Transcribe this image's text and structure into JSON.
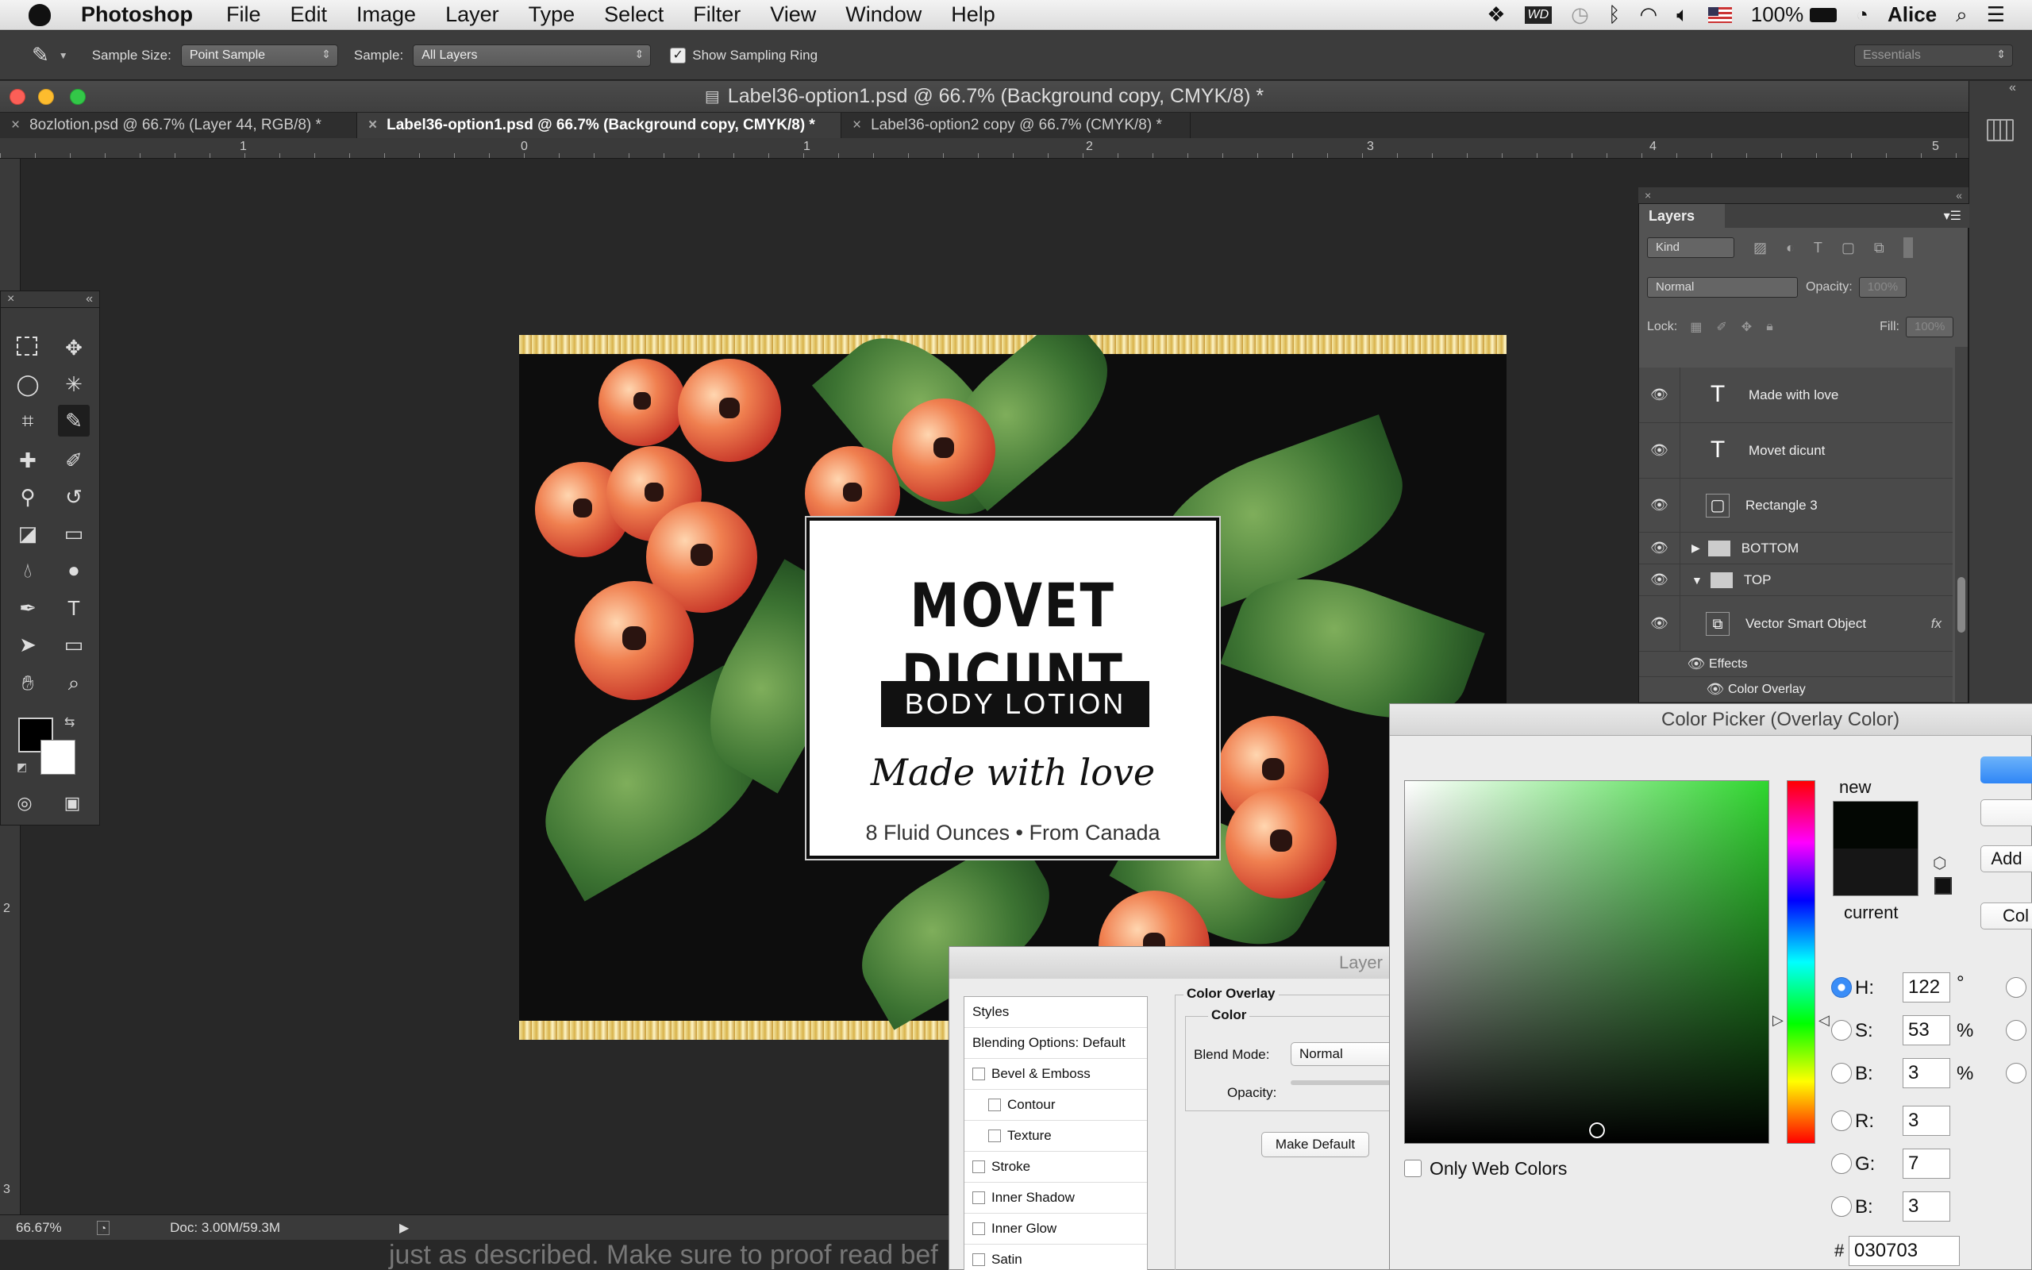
{
  "menubar": {
    "app": "Photoshop",
    "items": [
      "File",
      "Edit",
      "Image",
      "Layer",
      "Type",
      "Select",
      "Filter",
      "View",
      "Window",
      "Help"
    ],
    "battery": "100%",
    "user": "Alice"
  },
  "options": {
    "sample_size_label": "Sample Size:",
    "sample_size_value": "Point Sample",
    "sample_label": "Sample:",
    "sample_value": "All Layers",
    "show_ring_label": "Show Sampling Ring",
    "workspace": "Essentials"
  },
  "window": {
    "title": "Label36-option1.psd @ 66.7% (Background copy, CMYK/8) *",
    "tabs": [
      {
        "label": "8ozlotion.psd @ 66.7% (Layer 44, RGB/8) *"
      },
      {
        "label": "Label36-option1.psd @ 66.7% (Background copy, CMYK/8) *"
      },
      {
        "label": "Label36-option2 copy @ 66.7% (CMYK/8) *"
      }
    ],
    "ruler": [
      "1",
      "0",
      "1",
      "2",
      "3",
      "4",
      "5"
    ],
    "vruler": [
      "2",
      "3"
    ]
  },
  "label": {
    "title": "MOVET DICUNT",
    "band": "BODY LOTION",
    "script": "Made with love",
    "foot": "8 Fluid Ounces  •  From Canada"
  },
  "status": {
    "zoom": "66.67%",
    "doc": "Doc: 3.00M/59.3M",
    "behind_text": "just as described. Make sure to proof read bef"
  },
  "layers": {
    "title": "Layers",
    "kind": "Kind",
    "blend": "Normal",
    "opacity_label": "Opacity:",
    "opacity_value": "100%",
    "lock_label": "Lock:",
    "fill_label": "Fill:",
    "fill_value": "100%",
    "rows": [
      {
        "name": "Made with love"
      },
      {
        "name": "Movet dicunt"
      },
      {
        "name": "Rectangle 3"
      },
      {
        "name": "BOTTOM"
      },
      {
        "name": "TOP"
      },
      {
        "name": "Vector Smart Object"
      },
      {
        "name": "Effects"
      },
      {
        "name": "Color Overlay"
      }
    ],
    "fx": "fx"
  },
  "layer_style": {
    "title": "Layer",
    "styles_header": "Styles",
    "blending": "Blending Options: Default",
    "items": [
      "Bevel & Emboss",
      "Contour",
      "Texture",
      "Stroke",
      "Inner Shadow",
      "Inner Glow",
      "Satin"
    ],
    "section": "Color Overlay",
    "subsection": "Color",
    "blend_mode_label": "Blend Mode:",
    "blend_mode_value": "Normal",
    "opacity_label": "Opacity:",
    "make_default": "Make Default"
  },
  "picker": {
    "title": "Color Picker (Overlay Color)",
    "new_label": "new",
    "current_label": "current",
    "add_button": "Add",
    "col_button": "Col",
    "only_web": "Only Web Colors",
    "h_label": "H:",
    "h": "122",
    "h_unit": "°",
    "s_label": "S:",
    "s": "53",
    "s_unit": "%",
    "b_label": "B:",
    "b": "3",
    "b_unit": "%",
    "r_label": "R:",
    "r": "3",
    "g_label": "G:",
    "g": "7",
    "bb_label": "B:",
    "bb": "3",
    "hex_label": "#",
    "hex": "030703",
    "new_color": "#030703",
    "current_color": "#161616"
  }
}
